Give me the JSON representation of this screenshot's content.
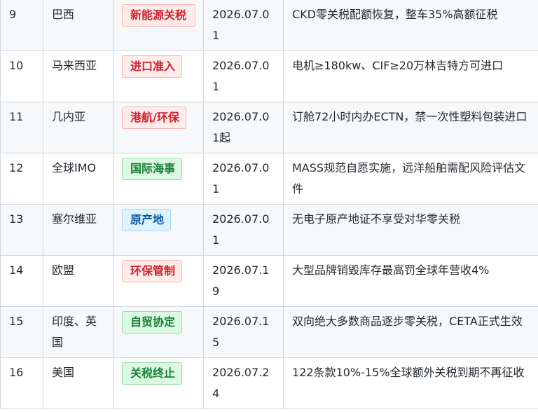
{
  "rows": [
    {
      "num": "9",
      "country": "巴西",
      "tag": "新能源关税",
      "tag_color": "red",
      "date": "2026.07.01",
      "desc": "CKD零关税配额恢复，整车35%高额征税"
    },
    {
      "num": "10",
      "country": "马来西亚",
      "tag": "进口准入",
      "tag_color": "red",
      "date": "2026.07.01",
      "desc": "电机≥180kw、CIF≥20万林吉特方可进口"
    },
    {
      "num": "11",
      "country": "几内亚",
      "tag": "港航/环保",
      "tag_color": "red",
      "date": "2026.07.01起",
      "desc": "订舱72小时内办ECTN，禁一次性塑料包装进口"
    },
    {
      "num": "12",
      "country": "全球IMO",
      "tag": "国际海事",
      "tag_color": "green",
      "date": "2026.07.01",
      "desc": "MASS规范自愿实施，远洋船舶需配风险评估文件"
    },
    {
      "num": "13",
      "country": "塞尔维亚",
      "tag": "原产地",
      "tag_color": "blue",
      "date": "2026.07.01",
      "desc": "无电子原产地证不享受对华零关税"
    },
    {
      "num": "14",
      "country": "欧盟",
      "tag": "环保管制",
      "tag_color": "red",
      "date": "2026.07.19",
      "desc": "大型品牌销毁库存最高罚全球年营收4%"
    },
    {
      "num": "15",
      "country": "印度、英国",
      "tag": "自贸协定",
      "tag_color": "green",
      "date": "2026.07.15",
      "desc": "双向绝大多数商品逐步零关税，CETA正式生效"
    },
    {
      "num": "16",
      "country": "美国",
      "tag": "关税终止",
      "tag_color": "green",
      "date": "2026.07.24",
      "desc": "122条款10%-15%全球额外关税到期不再征收"
    }
  ]
}
